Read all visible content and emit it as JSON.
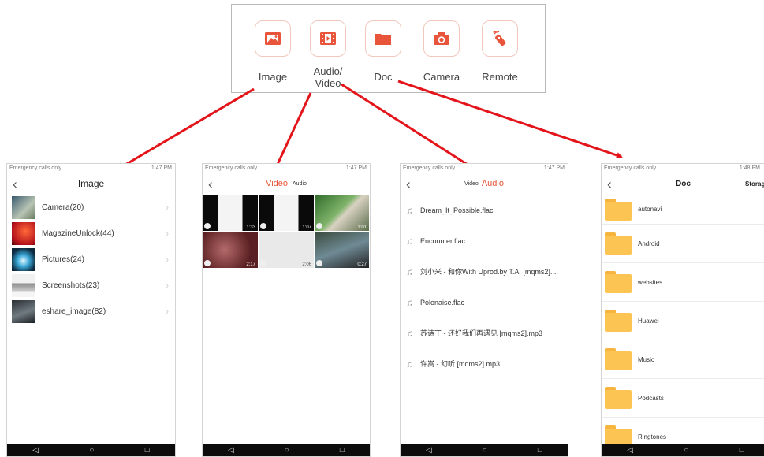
{
  "toolbar": {
    "items": [
      {
        "label": "Image",
        "icon": "image-icon"
      },
      {
        "label": "Audio/\nVideo",
        "icon": "film-icon"
      },
      {
        "label": "Doc",
        "icon": "folder-icon"
      },
      {
        "label": "Camera",
        "icon": "camera-icon"
      },
      {
        "label": "Remote",
        "icon": "remote-icon"
      }
    ],
    "accent": "#e8553a"
  },
  "phones": {
    "image": {
      "status_left": "Emergency calls only",
      "status_right": "1:47 PM",
      "title": "Image",
      "albums": [
        {
          "name": "Camera(20)"
        },
        {
          "name": "MagazineUnlock(44)"
        },
        {
          "name": "Pictures(24)"
        },
        {
          "name": "Screenshots(23)"
        },
        {
          "name": "eshare_image(82)"
        }
      ]
    },
    "video": {
      "status_left": "Emergency calls only",
      "status_right": "1:47 PM",
      "tab_active": "Video",
      "tab_other": "Audio",
      "durations": [
        "1:33",
        "1:07",
        "1:01",
        "2:17",
        "2:06",
        "0:27"
      ]
    },
    "audio": {
      "status_left": "Emergency calls only",
      "status_right": "1:47 PM",
      "tab_other": "Video",
      "tab_active": "Audio",
      "tracks": [
        "Dream_It_Possible.flac",
        "Encounter.flac",
        "刘小米 - 和你With Uprod.by T.A. [mqms2]....",
        "Polonaise.flac",
        "苏诗丁 - 还好我们再遇见 [mqms2].mp3",
        "许嵩 - 幻听 [mqms2].mp3"
      ]
    },
    "doc": {
      "status_left": "Emergency calls only",
      "status_right": "1:48 PM",
      "title": "Doc",
      "action": "Storag",
      "folders": [
        "autonavi",
        "Android",
        "websites",
        "Huawei",
        "Music",
        "Podcasts",
        "Ringtones"
      ]
    }
  },
  "navbar": {
    "back": "◁",
    "home": "○",
    "recent": "□"
  },
  "colors": {
    "accent": "#e8553a",
    "arrow": "#e3141a",
    "folder": "#fcc553"
  }
}
